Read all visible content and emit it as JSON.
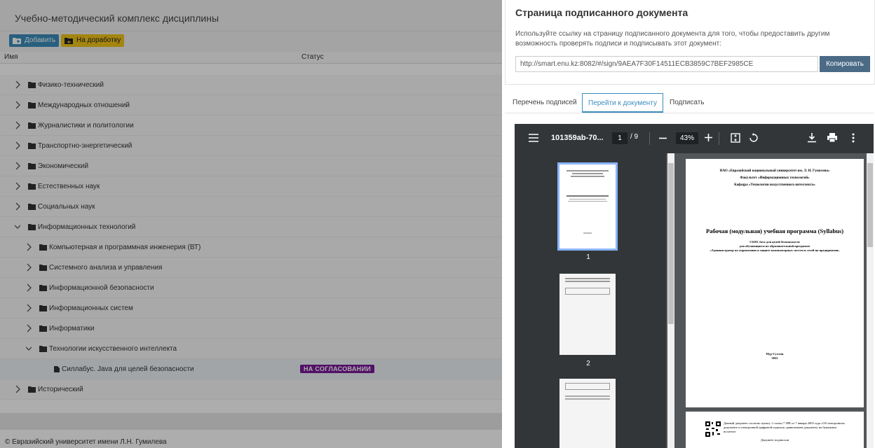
{
  "left": {
    "title": "Учебно-методический комплекс дисциплины",
    "buttons": {
      "add": "Добавить",
      "rework": "На доработку"
    },
    "columns": {
      "name": "Имя",
      "status": "Статус"
    },
    "rows": [
      {
        "label": "Физико-технический"
      },
      {
        "label": "Международных отношений"
      },
      {
        "label": "Журналистики и политологии"
      },
      {
        "label": "Транспортно-энергетический"
      },
      {
        "label": "Экономический"
      },
      {
        "label": "Естественных наук"
      },
      {
        "label": "Социальных наук"
      },
      {
        "label": "Информационных технологий"
      },
      {
        "label": "Компьютерная и программная инженерия (ВТ)"
      },
      {
        "label": "Системного анализа и управления"
      },
      {
        "label": "Информационной безопасности"
      },
      {
        "label": "Информационных систем"
      },
      {
        "label": "Информатики"
      },
      {
        "label": "Технологии искусственного интеллекта"
      },
      {
        "label": "Силлабус. Java для целей безопасности",
        "status": "НА СОГЛАСОВАНИИ"
      },
      {
        "label": "Исторический"
      }
    ],
    "footer": "© Евразийский университет имени Л.Н. Гумилева"
  },
  "right": {
    "heading": "Страница подписанного документа",
    "description": "Используйте ссылку на страницу подписанного документа для того, чтобы предоставить другим возможность проверять подписи и подписывать этот документ:",
    "link": "http://smart.enu.kz:8082/#/sign/9AEA7F30F14511ECB3859C7BEF2985CE",
    "copy_label": "Копировать",
    "tabs": {
      "signatures": "Перечень подписей",
      "document": "Перейти к документу",
      "sign": "Подписать"
    },
    "pdf": {
      "filename": "101359ab-70...",
      "page": "1",
      "total": "/ 9",
      "zoom": "43%",
      "thumb1": "1",
      "thumb2": "2",
      "page1": {
        "header1": "НАО «Евразийский национальный университет им. Л. Н. Гумилева»",
        "header2": "Факультет «Информационных технологий»",
        "header3": "Кафедра «Технологии искусственного интеллекта»",
        "title": "Рабочая (модульная) учебная программа (Syllabus)",
        "sub1": "С6103 Java для целей безопасности",
        "sub2": "для обучающихся по образовательной программе",
        "sub3": "«Администратор по управлению и защите компьютерных систем и сетей на предприятии»",
        "city": "Нур-Султан",
        "year": "2022"
      },
      "page2_text": "Данный документ согласно пункту 1 статьи 7 ЗРК от 7 января 2003 года «Об электронном документе и электронной цифровой подписи» равнозначен документу на бумажном носителе.",
      "page2_caption": "Документ подписали"
    }
  }
}
